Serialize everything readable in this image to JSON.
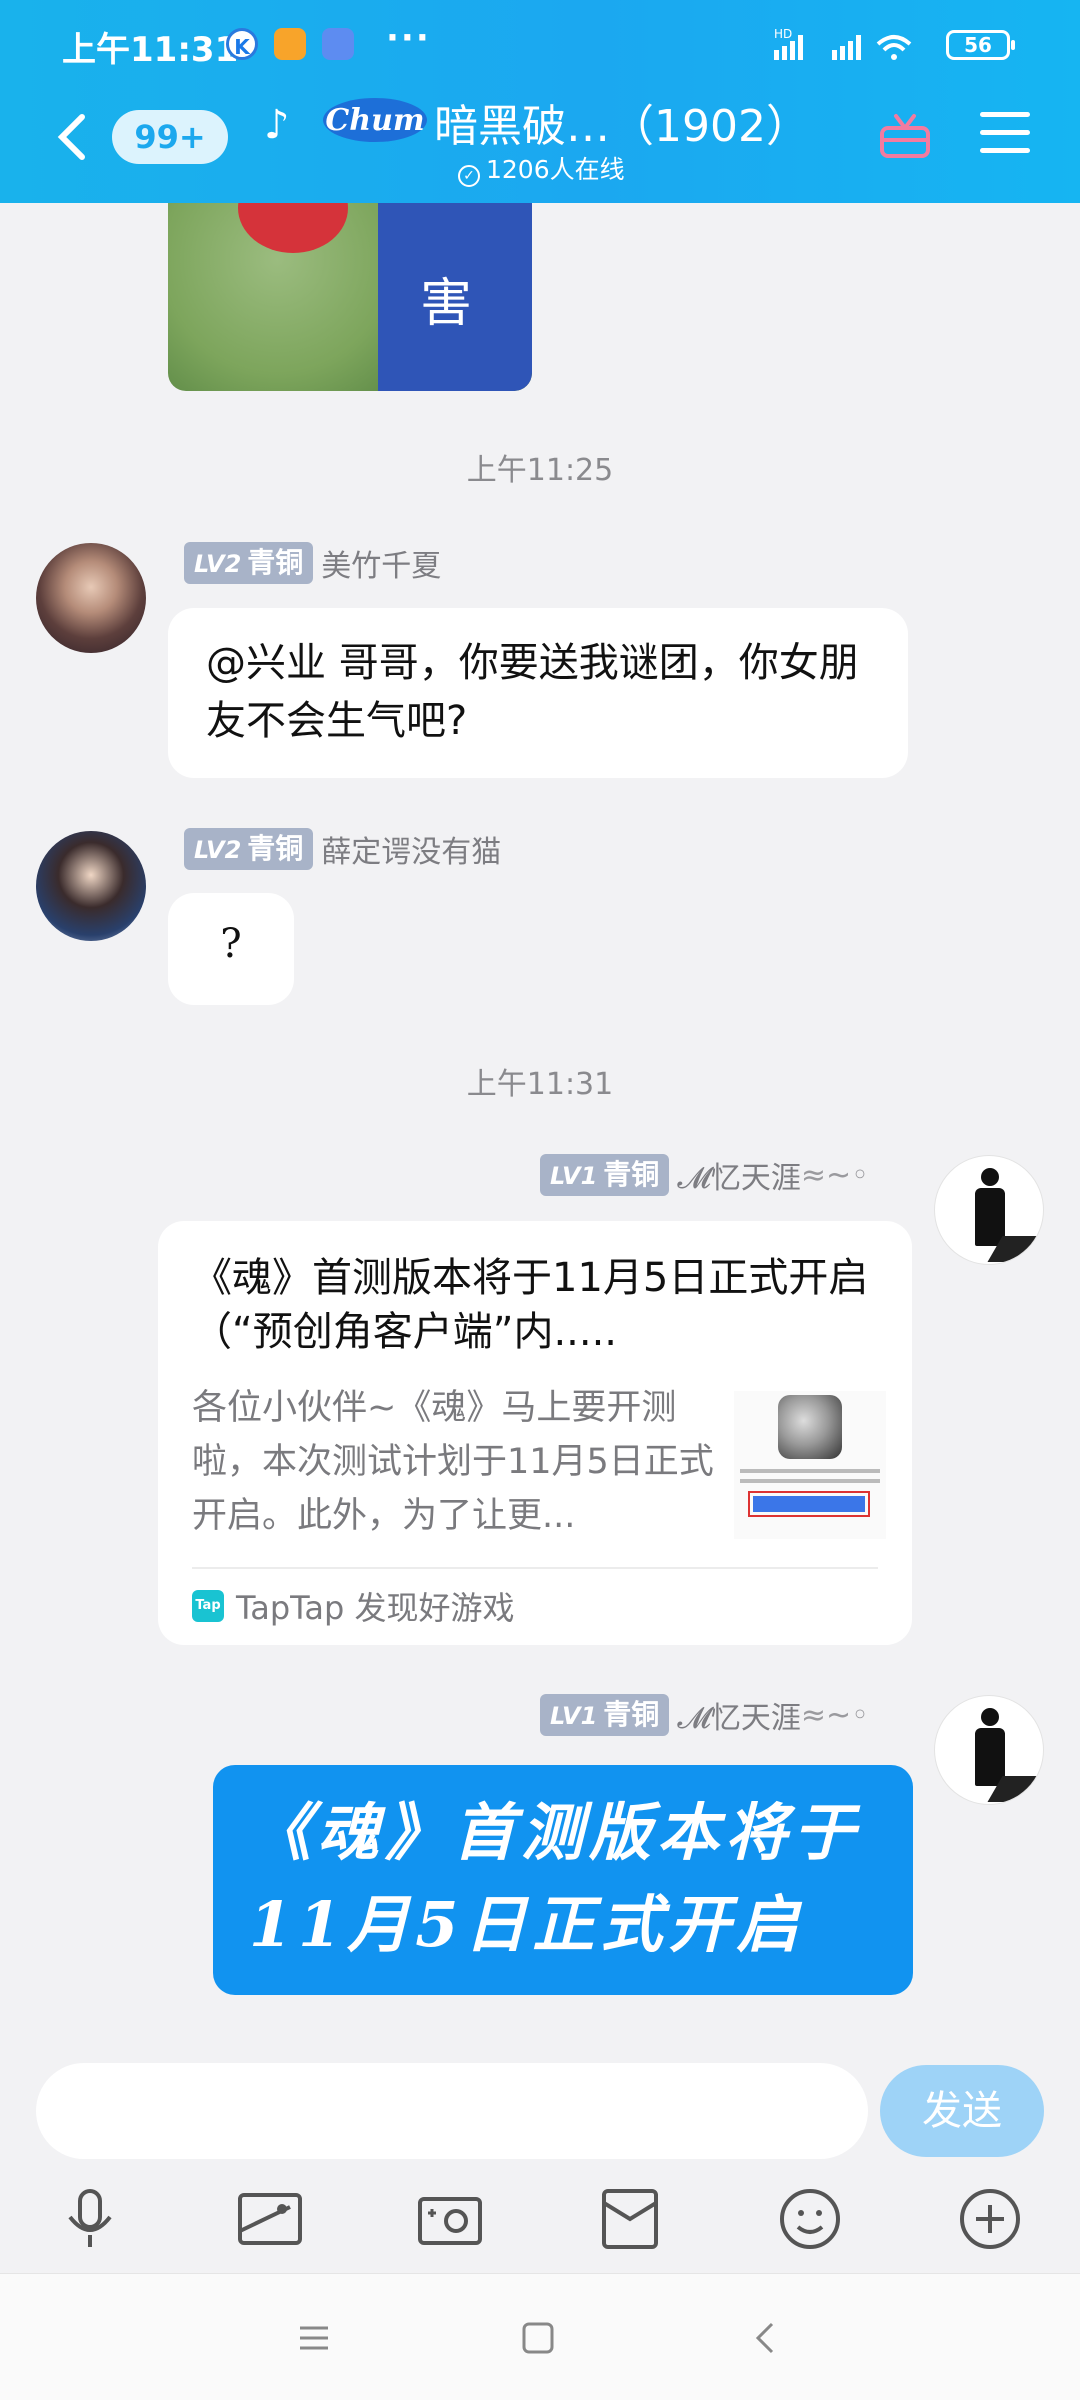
{
  "status_bar": {
    "time": "上午11:31",
    "notif_k": "K",
    "more": "···",
    "network": "HD",
    "battery": "56"
  },
  "header": {
    "unread_badge": "99+",
    "group_name": "暗黑破…（1902）",
    "online_count": "1206人在线"
  },
  "chat": {
    "image_caption": "害",
    "timestamps": [
      "上午11:25",
      "上午11:31"
    ],
    "messages": [
      {
        "level": "LV2",
        "rank": "青铜",
        "sender": "美竹千夏",
        "text": "@兴业 哥哥，你要送我谜团，你女朋友不会生气吧?"
      },
      {
        "level": "LV2",
        "rank": "青铜",
        "sender": "薛定谔没有猫",
        "text": "?"
      },
      {
        "level": "LV1",
        "rank": "青铜",
        "sender": "𝓜忆天涯",
        "card": {
          "title": "《魂》首测版本将于11月5日正式开启（“预创角客户端”内.....",
          "description": "各位小伙伴~《魂》马上要开测啦，本次测试计划于11月5日正式开启。此外，为了让更...",
          "source": "TapTap 发现好游戏",
          "source_icon": "Tap"
        }
      },
      {
        "level": "LV1",
        "rank": "青铜",
        "sender": "𝓜忆天涯",
        "big_text_line1": "《魂》首测版本将于",
        "big_text_line2": "11月5日正式开启"
      }
    ]
  },
  "composer": {
    "input_value": "",
    "send_label": "发送"
  },
  "toolbar_icons": [
    "microphone-icon",
    "image-icon",
    "camera-icon",
    "red-packet-icon",
    "emoji-icon",
    "plus-icon"
  ],
  "colors": {
    "header": "#19b2ec",
    "send_button": "#9ed3f7",
    "big_bubble": "#1193f0",
    "level_badge": "#a8b3c8"
  }
}
